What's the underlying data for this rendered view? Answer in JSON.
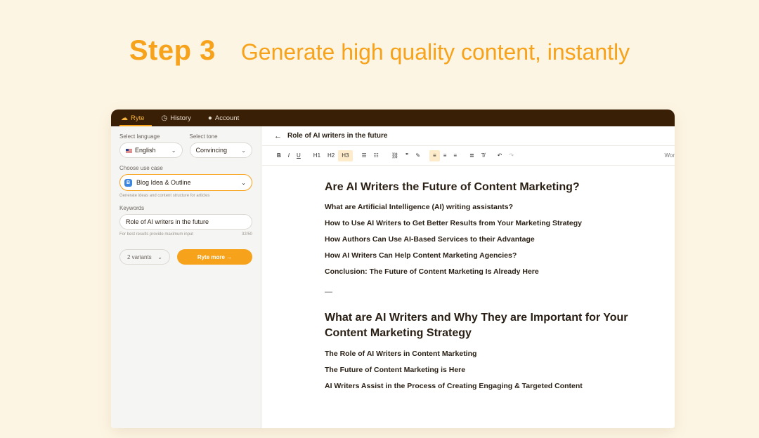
{
  "headline": {
    "step": "Step 3",
    "subtitle": "Generate high quality content, instantly"
  },
  "topbar": {
    "tabs": [
      {
        "label": "Ryte",
        "icon": "ryte-logo-icon",
        "active": true
      },
      {
        "label": "History",
        "icon": "clock-icon",
        "active": false
      },
      {
        "label": "Account",
        "icon": "user-icon",
        "active": false
      }
    ]
  },
  "sidebar": {
    "language_label": "Select language",
    "language_value": "English",
    "tone_label": "Select tone",
    "tone_value": "Convincing",
    "usecase_label": "Choose use case",
    "usecase_value": "Blog Idea & Outline",
    "usecase_hint": "Generate ideas and content structure for articles",
    "keywords_label": "Keywords",
    "keywords_value": "Role of AI writers in the future",
    "keywords_hint": "For best results provide maximum input",
    "keywords_count": "32/50",
    "variants_value": "2 variants",
    "ryte_button": "Ryte more →"
  },
  "editor": {
    "doc_title": "Role of AI writers in the future",
    "toolbar": {
      "bold": "B",
      "italic": "I",
      "underline": "U",
      "h1": "H1",
      "h2": "H2",
      "h3": "H3",
      "words_label": "Wor"
    },
    "sections": [
      {
        "heading": "Are AI Writers the Future of Content Marketing?",
        "items": [
          "What are Artificial Intelligence (AI) writing assistants?",
          "How to Use AI Writers to Get Better Results from Your Marketing Strategy",
          "How Authors Can Use AI-Based Services to their Advantage",
          "How AI Writers Can Help Content Marketing Agencies?",
          "Conclusion: The Future of Content Marketing Is Already Here"
        ]
      },
      {
        "heading": "What are AI Writers and Why They are Important for Your Content Marketing Strategy",
        "items": [
          "The Role of AI Writers in Content Marketing",
          "The Future of Content Marketing is Here",
          "AI Writers Assist in the Process of Creating Engaging & Targeted Content"
        ]
      }
    ],
    "separator": "—"
  },
  "colors": {
    "accent": "#f7a21b",
    "topbar": "#3a1f07",
    "background": "#fdf5e3"
  }
}
